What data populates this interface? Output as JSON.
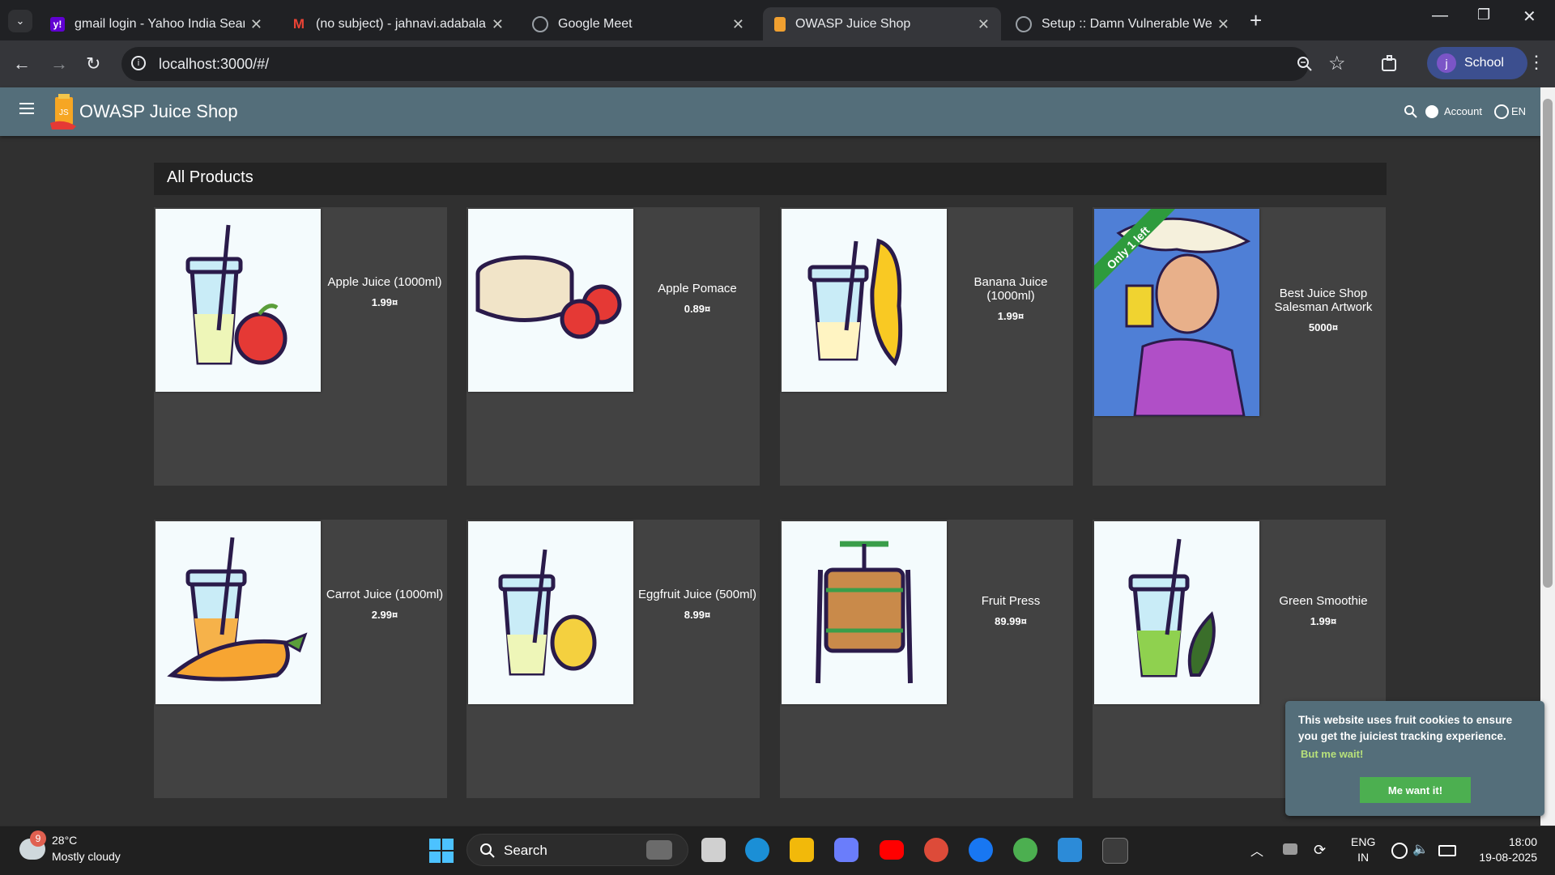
{
  "browser": {
    "tabs": [
      {
        "title": "gmail login - Yahoo India Search",
        "favicon": "yahoo-icon",
        "color": "#6001d2"
      },
      {
        "title": "(no subject) - jahnavi.adabala@",
        "favicon": "gmail-icon",
        "color": "#ea4335"
      },
      {
        "title": "Google Meet",
        "favicon": "globe-icon",
        "color": "#9aa0a6"
      },
      {
        "title": "OWASP Juice Shop",
        "favicon": "juice-shop-icon",
        "color": "#f0a030"
      },
      {
        "title": "Setup :: Damn Vulnerable Web",
        "favicon": "dvwa-icon",
        "color": "#9aa0a6"
      }
    ],
    "active_tab_index": 3,
    "url": "localhost:3000/#/",
    "profile_initial": "j",
    "profile_label": "School"
  },
  "app": {
    "title": "OWASP Juice Shop",
    "account_label": "Account",
    "language_label": "EN",
    "section_title": "All Products"
  },
  "products": [
    {
      "name": "Apple Juice (1000ml)",
      "price": "1.99¤",
      "icon": "apple-juice-image"
    },
    {
      "name": "Apple Pomace",
      "price": "0.89¤",
      "icon": "apple-pomace-image"
    },
    {
      "name": "Banana Juice (1000ml)",
      "price": "1.99¤",
      "icon": "banana-juice-image"
    },
    {
      "name": "Best Juice Shop Salesman Artwork",
      "price": "5000¤",
      "icon": "salesman-artwork-image",
      "ribbon": "Only 1 left"
    },
    {
      "name": "Carrot Juice (1000ml)",
      "price": "2.99¤",
      "icon": "carrot-juice-image"
    },
    {
      "name": "Eggfruit Juice (500ml)",
      "price": "8.99¤",
      "icon": "eggfruit-juice-image"
    },
    {
      "name": "Fruit Press",
      "price": "89.99¤",
      "icon": "fruit-press-image"
    },
    {
      "name": "Green Smoothie",
      "price": "1.99¤",
      "icon": "green-smoothie-image"
    }
  ],
  "cookie_banner": {
    "message": "This website uses fruit cookies to ensure you get the juiciest tracking experience.",
    "link_label": "But me wait!",
    "button_label": "Me want it!"
  },
  "taskbar": {
    "weather_badge": "9",
    "temperature": "28°C",
    "weather_desc": "Mostly cloudy",
    "search_label": "Search",
    "lang_line1": "ENG",
    "lang_line2": "IN",
    "time": "18:00",
    "date": "19-08-2025"
  }
}
